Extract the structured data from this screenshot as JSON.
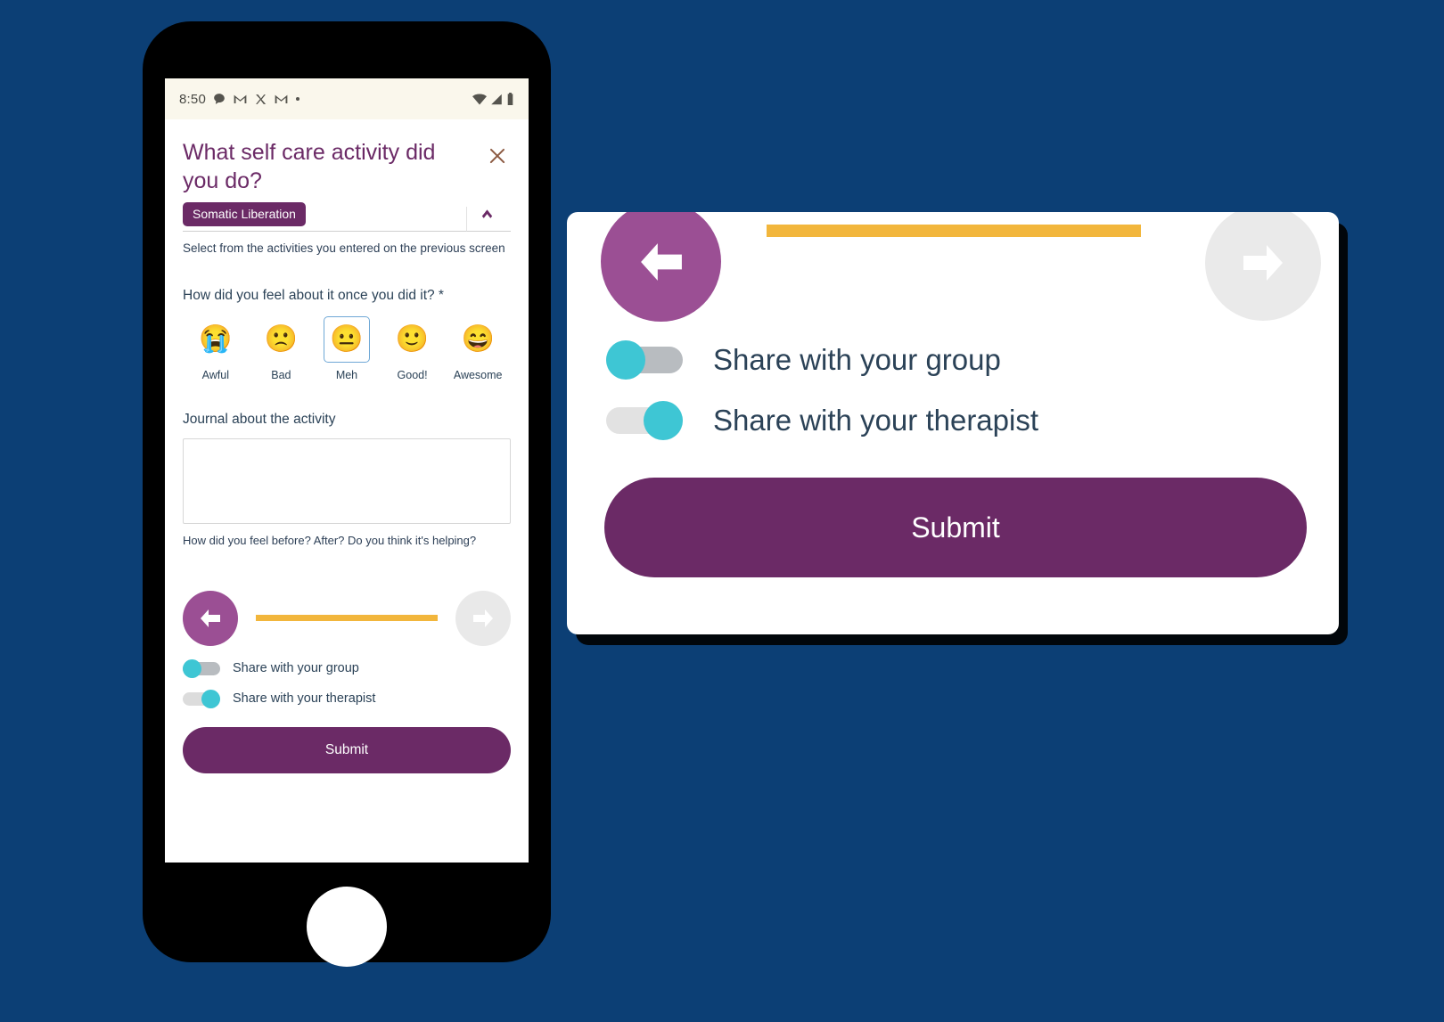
{
  "phone": {
    "status_bar": {
      "time": "8:50",
      "left_icons": [
        "chat-bubble-icon",
        "gmail-icon",
        "x-app-icon",
        "gmail-icon",
        "dot-icon"
      ],
      "right_icons": [
        "wifi-icon",
        "signal-icon",
        "battery-icon"
      ]
    },
    "screen": {
      "title": "What self care activity did you do?",
      "close_label": "×",
      "activity": {
        "chip_label": "Somatic Liberation",
        "helper": "Select from the activities you entered on the previous screen"
      },
      "feeling": {
        "label": "How did you feel about it once you did it? *",
        "options": [
          {
            "glyph": "😭",
            "label": "Awful",
            "selected": false
          },
          {
            "glyph": "🙁",
            "label": "Bad",
            "selected": false
          },
          {
            "glyph": "😐",
            "label": "Meh",
            "selected": true
          },
          {
            "glyph": "🙂",
            "label": "Good!",
            "selected": false
          },
          {
            "glyph": "😄",
            "label": "Awesome",
            "selected": false
          }
        ]
      },
      "journal": {
        "label": "Journal about the activity",
        "value": "",
        "placeholder": "",
        "helper": "How did you feel before? After? Do you think it's helping?"
      },
      "nav": {
        "back_label": "back-arrow",
        "forward_label": "forward-arrow",
        "progress_percent": 100
      },
      "sharing": [
        {
          "label": "Share with your group",
          "on": false
        },
        {
          "label": "Share with your therapist",
          "on": true
        }
      ],
      "submit_label": "Submit"
    }
  },
  "zoom_panel": {
    "nav": {
      "back_label": "back-arrow",
      "forward_label": "forward-arrow",
      "progress_percent": 100
    },
    "sharing": [
      {
        "label": "Share with your group",
        "on": false
      },
      {
        "label": "Share with your therapist",
        "on": true
      }
    ],
    "submit_label": "Submit"
  },
  "colors": {
    "background": "#0C3F75",
    "purple": "#6B2A66",
    "purple_light": "#9B4F94",
    "teal": "#3EC6D4",
    "orange": "#F2B63C",
    "text_blue": "#2B4257",
    "grey": "#E9E9E9",
    "close_x": "#8C5A42",
    "selection_border": "#6FA8D6",
    "status_bar_bg": "#FAF7EC"
  }
}
